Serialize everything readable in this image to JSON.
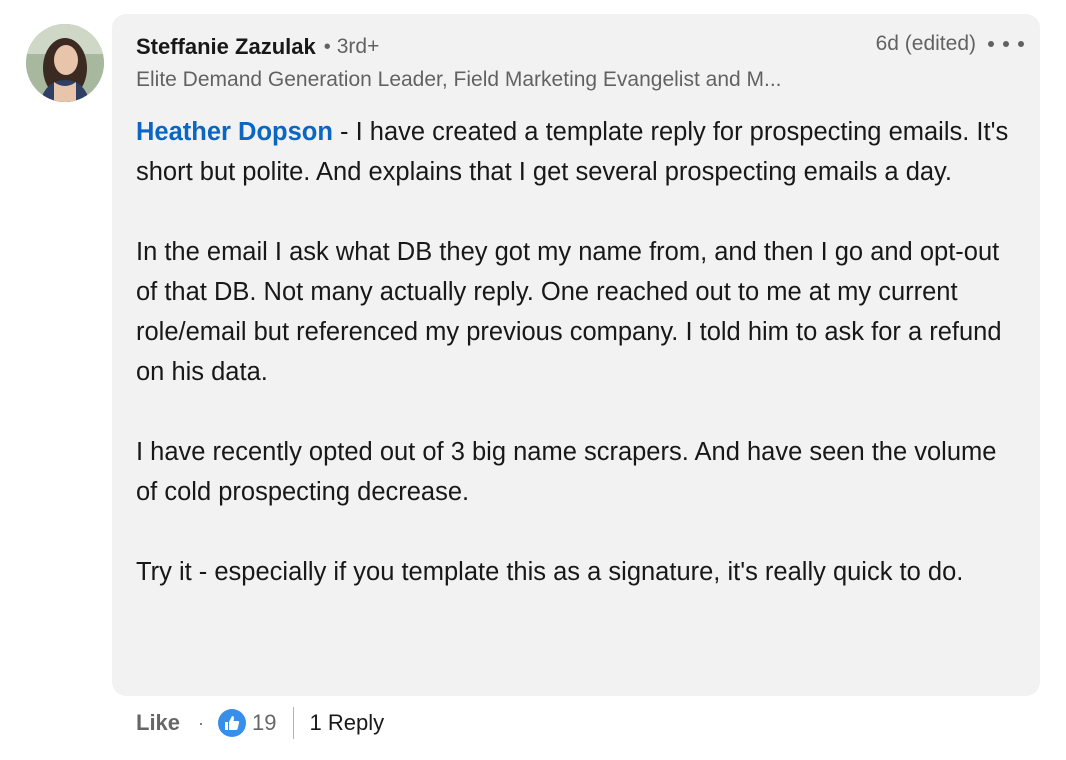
{
  "comment": {
    "author": {
      "name": "Steffanie Zazulak",
      "degree": "3rd+",
      "headline": "Elite Demand Generation Leader, Field Marketing Evangelist and M..."
    },
    "separator": "•",
    "timestamp": "6d (edited)",
    "more_icon": "ellipsis-icon",
    "mention": "Heather Dopson",
    "paragraphs": [
      " - I have created a template reply for prospecting emails. It's short but polite. And explains that I get several prospecting emails a day.",
      "In the email I ask what DB they got my name from, and then I go and opt-out of that DB. Not many actually reply. One reached out to me at my current role/email but referenced my previous company. I told him to ask for a refund on his data.",
      "I have recently opted out of 3 big name scrapers. And have seen the volume of cold prospecting decrease.",
      "Try it - especially if you template this as a signature, it's really quick to do."
    ]
  },
  "actions": {
    "like_label": "Like",
    "dot": "·",
    "reaction_icon": "thumbs-up-icon",
    "reaction_count": "19",
    "reply_label": "1 Reply"
  },
  "colors": {
    "mention": "#0a66c2",
    "bubble": "#f2f2f2",
    "like_reaction": "#378fe9"
  }
}
